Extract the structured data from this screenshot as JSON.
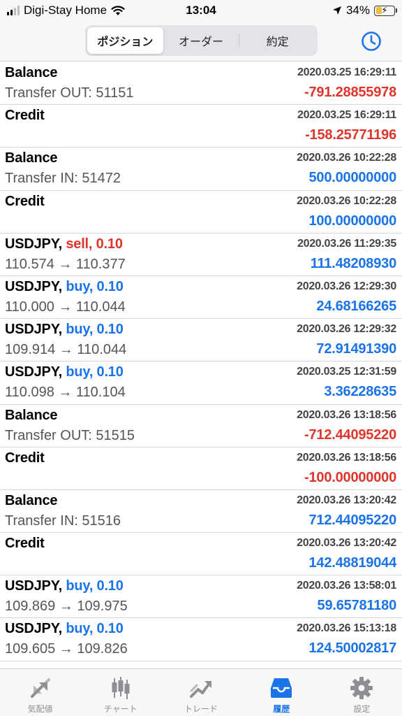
{
  "status_bar": {
    "carrier": "Digi-Stay Home",
    "time": "13:04",
    "battery": "34%",
    "battery_level": 0.34
  },
  "nav": {
    "segments": [
      {
        "label": "ポジション",
        "active": true
      },
      {
        "label": "オーダー",
        "active": false
      },
      {
        "label": "約定",
        "active": false
      }
    ],
    "right_icon": "clock-icon"
  },
  "history": [
    {
      "title": "Balance",
      "side": "",
      "timestamp": "2020.03.25 16:29:11",
      "detail": "Transfer OUT: 51151",
      "amount": "-791.28855978"
    },
    {
      "title": "Credit",
      "side": "",
      "timestamp": "2020.03.25 16:29:11",
      "detail": "",
      "amount": "-158.25771196"
    },
    {
      "title": "Balance",
      "side": "",
      "timestamp": "2020.03.26 10:22:28",
      "detail": "Transfer IN: 51472",
      "amount": "500.00000000"
    },
    {
      "title": "Credit",
      "side": "",
      "timestamp": "2020.03.26 10:22:28",
      "detail": "",
      "amount": "100.00000000"
    },
    {
      "title": "USDJPY,",
      "side": "sell, 0.10",
      "timestamp": "2020.03.26 11:29:35",
      "detail": "110.574 → 110.377",
      "amount": "111.48208930"
    },
    {
      "title": "USDJPY,",
      "side": "buy, 0.10",
      "timestamp": "2020.03.26 12:29:30",
      "detail": "110.000 → 110.044",
      "amount": "24.68166265"
    },
    {
      "title": "USDJPY,",
      "side": "buy, 0.10",
      "timestamp": "2020.03.26 12:29:32",
      "detail": "109.914 → 110.044",
      "amount": "72.91491390"
    },
    {
      "title": "USDJPY,",
      "side": "buy, 0.10",
      "timestamp": "2020.03.25 12:31:59",
      "detail": "110.098 → 110.104",
      "amount": "3.36228635"
    },
    {
      "title": "Balance",
      "side": "",
      "timestamp": "2020.03.26 13:18:56",
      "detail": "Transfer OUT: 51515",
      "amount": "-712.44095220"
    },
    {
      "title": "Credit",
      "side": "",
      "timestamp": "2020.03.26 13:18:56",
      "detail": "",
      "amount": "-100.00000000"
    },
    {
      "title": "Balance",
      "side": "",
      "timestamp": "2020.03.26 13:20:42",
      "detail": "Transfer IN: 51516",
      "amount": "712.44095220"
    },
    {
      "title": "Credit",
      "side": "",
      "timestamp": "2020.03.26 13:20:42",
      "detail": "",
      "amount": "142.48819044"
    },
    {
      "title": "USDJPY,",
      "side": "buy, 0.10",
      "timestamp": "2020.03.26 13:58:01",
      "detail": "109.869 → 109.975",
      "amount": "59.65781180"
    },
    {
      "title": "USDJPY,",
      "side": "buy, 0.10",
      "timestamp": "2020.03.26 15:13:18",
      "detail": "109.605 → 109.826",
      "amount": "124.50002817"
    }
  ],
  "tabs": [
    {
      "label": "気配値",
      "icon": "quotes-icon",
      "active": false
    },
    {
      "label": "チャート",
      "icon": "candlestick-icon",
      "active": false
    },
    {
      "label": "トレード",
      "icon": "trade-icon",
      "active": false
    },
    {
      "label": "履歴",
      "icon": "history-inbox-icon",
      "active": true
    },
    {
      "label": "設定",
      "icon": "gear-icon",
      "active": false
    }
  ],
  "colors": {
    "positive": "#1a73e8",
    "negative": "#e0352b",
    "accent": "#1a73e8"
  }
}
